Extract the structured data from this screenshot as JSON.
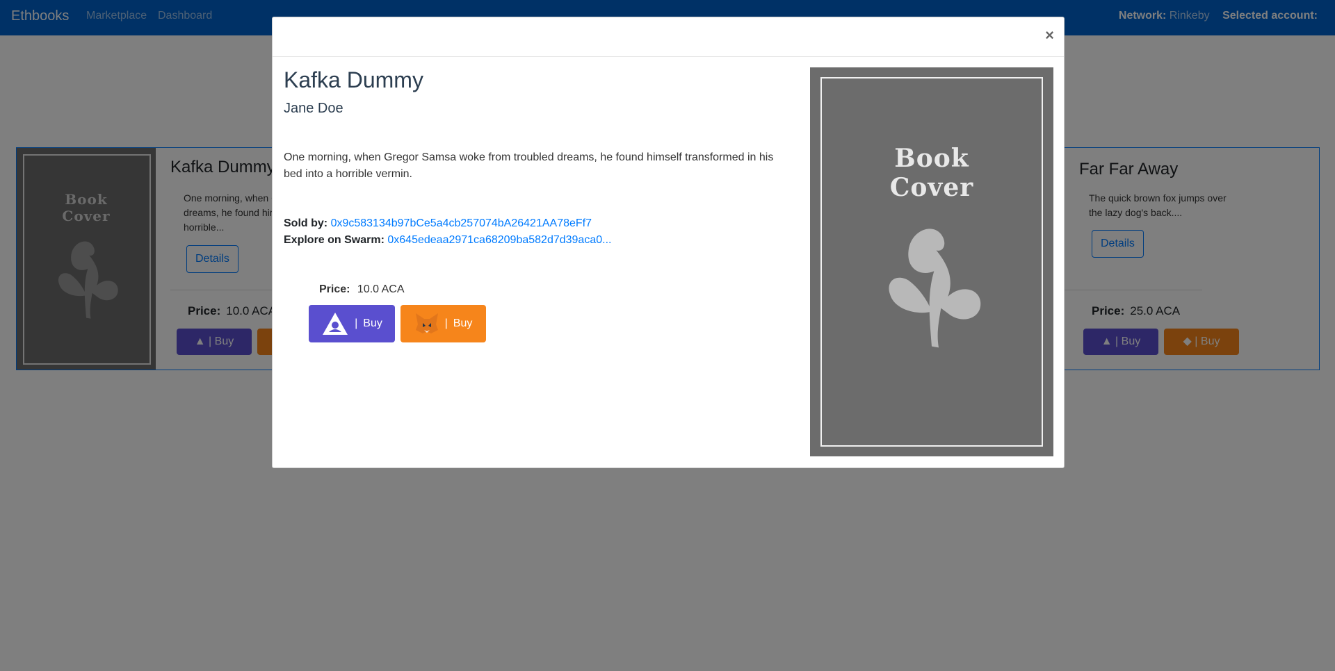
{
  "navbar": {
    "brand": "Ethbooks",
    "links": [
      "Marketplace",
      "Dashboard"
    ],
    "network_label": "Network:",
    "network_value": "Rinkeby",
    "account_label": "Selected account:"
  },
  "background_cards": [
    {
      "cover_title_line1": "Book",
      "cover_title_line2": "Cover",
      "title": "Kafka Dummy",
      "description": "One morning, when Gregor Samsa woke from troubled dreams, he found himself transformed in his bed into a horrible...",
      "details_label": "Details",
      "price_label": "Price:",
      "price_value": "10.0 ACA",
      "buy_label": "Buy"
    },
    {
      "title": "Far Far Away",
      "description": "The quick brown fox jumps over the lazy dog's back....",
      "details_label": "Details",
      "price_label": "Price:",
      "price_value": "25.0 ACA",
      "buy_label": "Buy"
    }
  ],
  "modal": {
    "close_label": "×",
    "title": "Kafka Dummy",
    "author": "Jane Doe",
    "description": "One morning, when Gregor Samsa woke from troubled dreams, he found himself transformed in his bed into a horrible vermin.",
    "sold_by_label": "Sold by:",
    "sold_by_value": "0x9c583134b97bCe5a4cb257074bA26421AA78eFf7",
    "swarm_label": "Explore on Swarm:",
    "swarm_value": "0x645edeaa2971ca68209ba582d7d39aca0...",
    "price_label": "Price:",
    "price_value": "10.0 ACA",
    "pipe": "|",
    "buy_label": "Buy",
    "cover_title_line1": "Book",
    "cover_title_line2": "Cover"
  },
  "colors": {
    "navbar": "#0062cc",
    "link": "#007bff",
    "aca_button": "#5a4fcf",
    "metamask_button": "#f6851b",
    "cover": "#6c6c6c"
  }
}
